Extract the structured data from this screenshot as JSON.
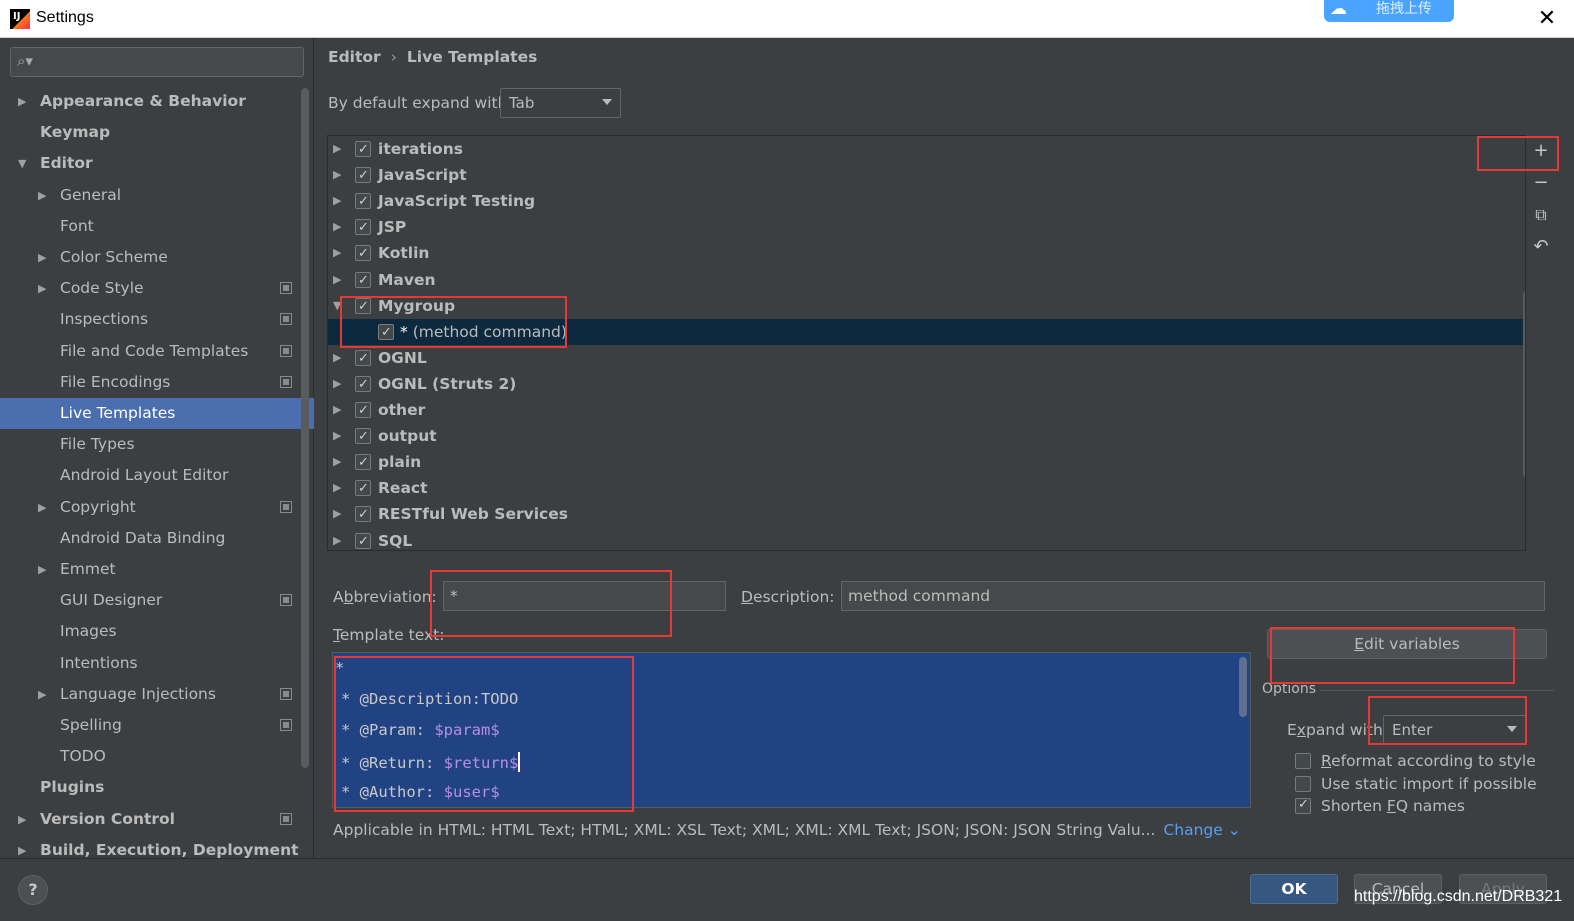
{
  "window": {
    "title": "Settings",
    "upload_badge": "拖拽上传",
    "close_glyph": "✕"
  },
  "sidebar": {
    "search_placeholder": "",
    "items": [
      {
        "label": "Appearance & Behavior",
        "level": 0,
        "bold": true,
        "arrow": "▶"
      },
      {
        "label": "Keymap",
        "level": 0,
        "bold": true,
        "arrow": ""
      },
      {
        "label": "Editor",
        "level": 0,
        "bold": true,
        "arrow": "▼"
      },
      {
        "label": "General",
        "level": 1,
        "arrow": "▶"
      },
      {
        "label": "Font",
        "level": 1,
        "arrow": ""
      },
      {
        "label": "Color Scheme",
        "level": 1,
        "arrow": "▶"
      },
      {
        "label": "Code Style",
        "level": 1,
        "arrow": "▶",
        "project": true
      },
      {
        "label": "Inspections",
        "level": 1,
        "arrow": "",
        "project": true
      },
      {
        "label": "File and Code Templates",
        "level": 1,
        "arrow": "",
        "project": true
      },
      {
        "label": "File Encodings",
        "level": 1,
        "arrow": "",
        "project": true
      },
      {
        "label": "Live Templates",
        "level": 1,
        "arrow": "",
        "selected": true
      },
      {
        "label": "File Types",
        "level": 1,
        "arrow": ""
      },
      {
        "label": "Android Layout Editor",
        "level": 1,
        "arrow": ""
      },
      {
        "label": "Copyright",
        "level": 1,
        "arrow": "▶",
        "project": true
      },
      {
        "label": "Android Data Binding",
        "level": 1,
        "arrow": ""
      },
      {
        "label": "Emmet",
        "level": 1,
        "arrow": "▶"
      },
      {
        "label": "GUI Designer",
        "level": 1,
        "arrow": "",
        "project": true
      },
      {
        "label": "Images",
        "level": 1,
        "arrow": ""
      },
      {
        "label": "Intentions",
        "level": 1,
        "arrow": ""
      },
      {
        "label": "Language Injections",
        "level": 1,
        "arrow": "▶",
        "project": true
      },
      {
        "label": "Spelling",
        "level": 1,
        "arrow": "",
        "project": true
      },
      {
        "label": "TODO",
        "level": 1,
        "arrow": ""
      },
      {
        "label": "Plugins",
        "level": 0,
        "bold": true,
        "arrow": ""
      },
      {
        "label": "Version Control",
        "level": 0,
        "bold": true,
        "arrow": "▶",
        "project": true
      },
      {
        "label": "Build, Execution, Deployment",
        "level": 0,
        "bold": true,
        "arrow": "▶"
      }
    ]
  },
  "breadcrumb": {
    "parent": "Editor",
    "separator": "›",
    "current": "Live Templates"
  },
  "expand_default": {
    "label": "By default expand with",
    "value": "Tab"
  },
  "template_groups": [
    {
      "label": "iterations",
      "checked": true,
      "arrow": "▶"
    },
    {
      "label": "JavaScript",
      "checked": true,
      "arrow": "▶"
    },
    {
      "label": "JavaScript Testing",
      "checked": true,
      "arrow": "▶"
    },
    {
      "label": "JSP",
      "checked": true,
      "arrow": "▶"
    },
    {
      "label": "Kotlin",
      "checked": true,
      "arrow": "▶"
    },
    {
      "label": "Maven",
      "checked": true,
      "arrow": "▶"
    },
    {
      "label": "Mygroup",
      "checked": true,
      "arrow": "▼"
    },
    {
      "label": "(method command)",
      "abbr": "*",
      "checked": true,
      "child": true,
      "selected": true
    },
    {
      "label": "OGNL",
      "checked": true,
      "arrow": "▶"
    },
    {
      "label": "OGNL (Struts 2)",
      "checked": true,
      "arrow": "▶"
    },
    {
      "label": "other",
      "checked": true,
      "arrow": "▶"
    },
    {
      "label": "output",
      "checked": true,
      "arrow": "▶"
    },
    {
      "label": "plain",
      "checked": true,
      "arrow": "▶"
    },
    {
      "label": "React",
      "checked": true,
      "arrow": "▶"
    },
    {
      "label": "RESTful Web Services",
      "checked": true,
      "arrow": "▶"
    },
    {
      "label": "SQL",
      "checked": true,
      "arrow": "▶"
    }
  ],
  "toolbar": {
    "add": "+",
    "remove": "−",
    "copy": "⧉",
    "restore": "↶"
  },
  "abbreviation": {
    "label_pre": "A",
    "label_u": "b",
    "label_post": "breviation:",
    "value": "*"
  },
  "description": {
    "label_u": "D",
    "label_post": "escription:",
    "value": "method command"
  },
  "template_text": {
    "label_u": "T",
    "label_post": "emplate text:",
    "lines": [
      {
        "pre": "*",
        "var": ""
      },
      {
        "pre": "* @Description:TODO",
        "var": ""
      },
      {
        "pre": "* @Param: ",
        "var": "$param$"
      },
      {
        "pre": "* @Return: ",
        "var": "$return$"
      },
      {
        "pre": "* @Author: ",
        "var": "$user$"
      }
    ]
  },
  "edit_variables": {
    "label_u": "E",
    "label_post": "dit variables"
  },
  "options": {
    "title": "Options",
    "expand_label_pre": "E",
    "expand_label_u": "x",
    "expand_label_post": "pand with",
    "expand_value": "Enter",
    "checkboxes": [
      {
        "pre": "",
        "u": "R",
        "post": "eformat according to style",
        "checked": false
      },
      {
        "pre": "Use static import if possible",
        "u": "",
        "post": "",
        "checked": false
      },
      {
        "pre": "Shorten ",
        "u": "F",
        "post": "Q names",
        "checked": true
      }
    ]
  },
  "applicable": {
    "text": "Applicable in HTML: HTML Text; HTML; XML: XSL Text; XML; XML: XML Text; JSON; JSON: JSON String Valu...",
    "change": "Change ⌄"
  },
  "buttons": {
    "help": "?",
    "ok": "OK",
    "cancel": "Cancel",
    "apply": "Apply"
  },
  "watermark": "https://blog.csdn.net/DRB321",
  "colors": {
    "panel": "#3c3f41",
    "selection": "#4b6eaf",
    "editor_bg": "#214283",
    "highlight_box": "#e53935",
    "link": "#589df6"
  }
}
